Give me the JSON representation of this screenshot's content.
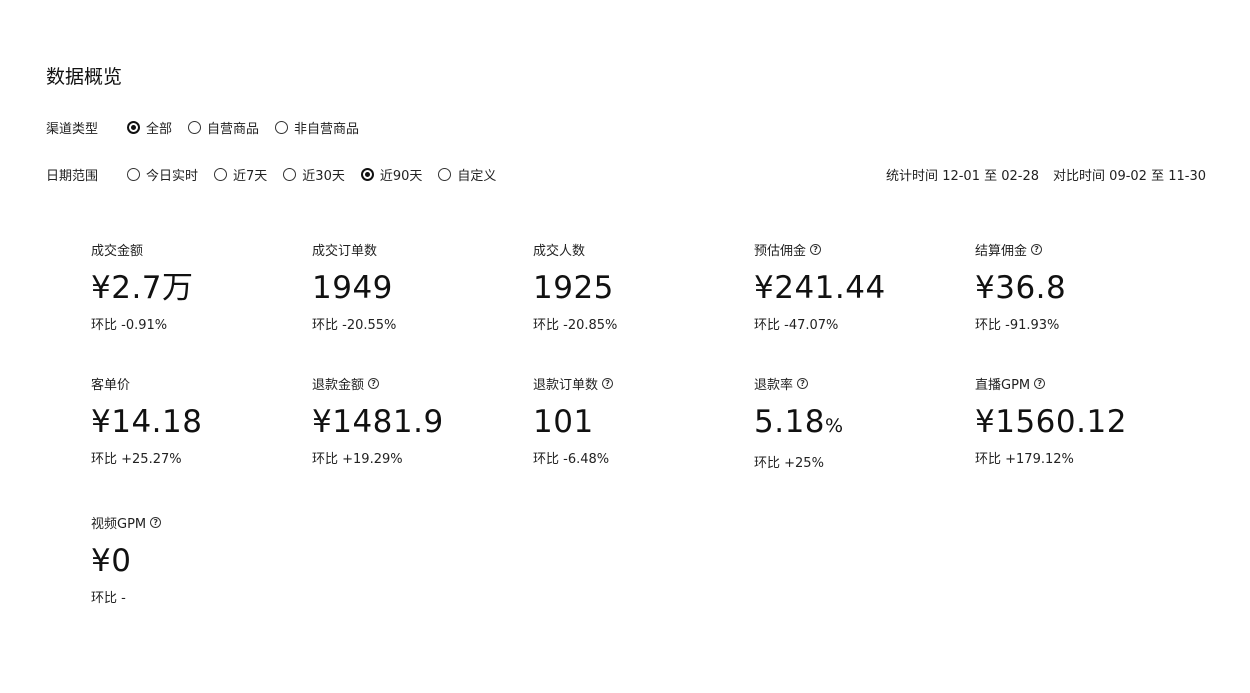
{
  "title": "数据概览",
  "channel_filter": {
    "label": "渠道类型",
    "options": [
      {
        "label": "全部",
        "selected": true
      },
      {
        "label": "自营商品",
        "selected": false
      },
      {
        "label": "非自营商品",
        "selected": false
      }
    ]
  },
  "date_filter": {
    "label": "日期范围",
    "options": [
      {
        "label": "今日实时",
        "selected": false
      },
      {
        "label": "近7天",
        "selected": false
      },
      {
        "label": "近30天",
        "selected": false
      },
      {
        "label": "近90天",
        "selected": true
      },
      {
        "label": "自定义",
        "selected": false
      }
    ]
  },
  "period": {
    "stat_label": "统计时间",
    "stat_range": "12-01 至 02-28",
    "compare_label": "对比时间",
    "compare_range": "09-02 至 11-30"
  },
  "metrics": [
    {
      "label": "成交金额",
      "value": "¥2.7万",
      "unit": "",
      "compare": "环比 -0.91%",
      "help": false
    },
    {
      "label": "成交订单数",
      "value": "1949",
      "unit": "",
      "compare": "环比 -20.55%",
      "help": false
    },
    {
      "label": "成交人数",
      "value": "1925",
      "unit": "",
      "compare": "环比 -20.85%",
      "help": false
    },
    {
      "label": "预估佣金",
      "value": "¥241.44",
      "unit": "",
      "compare": "环比 -47.07%",
      "help": true
    },
    {
      "label": "结算佣金",
      "value": "¥36.8",
      "unit": "",
      "compare": "环比 -91.93%",
      "help": true
    },
    {
      "label": "客单价",
      "value": "¥14.18",
      "unit": "",
      "compare": "环比 +25.27%",
      "help": false
    },
    {
      "label": "退款金额",
      "value": "¥1481.9",
      "unit": "",
      "compare": "环比 +19.29%",
      "help": true
    },
    {
      "label": "退款订单数",
      "value": "101",
      "unit": "",
      "compare": "环比 -6.48%",
      "help": true
    },
    {
      "label": "退款率",
      "value": "5.18",
      "unit": "%",
      "compare": "环比 +25%",
      "help": true
    },
    {
      "label": "直播GPM",
      "value": "¥1560.12",
      "unit": "",
      "compare": "环比 +179.12%",
      "help": true
    },
    {
      "label": "视频GPM",
      "value": "¥0",
      "unit": "",
      "compare": "环比 -",
      "help": true
    }
  ]
}
